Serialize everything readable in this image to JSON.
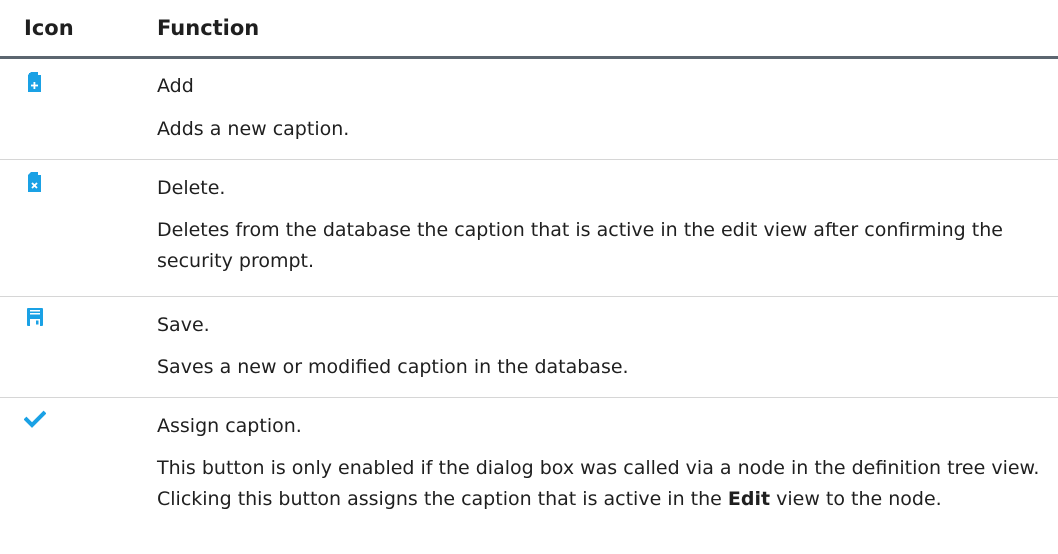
{
  "header": {
    "icon_col": "Icon",
    "function_col": "Function"
  },
  "colors": {
    "icon_blue": "#1aa1e5",
    "header_rule": "#5c6670",
    "row_rule": "#d6d6d6"
  },
  "rows": [
    {
      "icon": "add-document-icon",
      "name": "Add",
      "description": "Adds a new caption."
    },
    {
      "icon": "delete-document-icon",
      "name": "Delete.",
      "description": "Deletes from the database the caption that is active in the edit view after confirming the security prompt."
    },
    {
      "icon": "save-disk-icon",
      "name": "Save.",
      "description": "Saves a new or modified caption in the database."
    },
    {
      "icon": "checkmark-icon",
      "name": "Assign caption.",
      "description_parts": {
        "before": "This button is only enabled if the dialog box was called via a node in the definition tree view. Clicking this button assigns the caption that is active in the ",
        "bold": "Edit",
        "after": " view to the node."
      }
    }
  ]
}
